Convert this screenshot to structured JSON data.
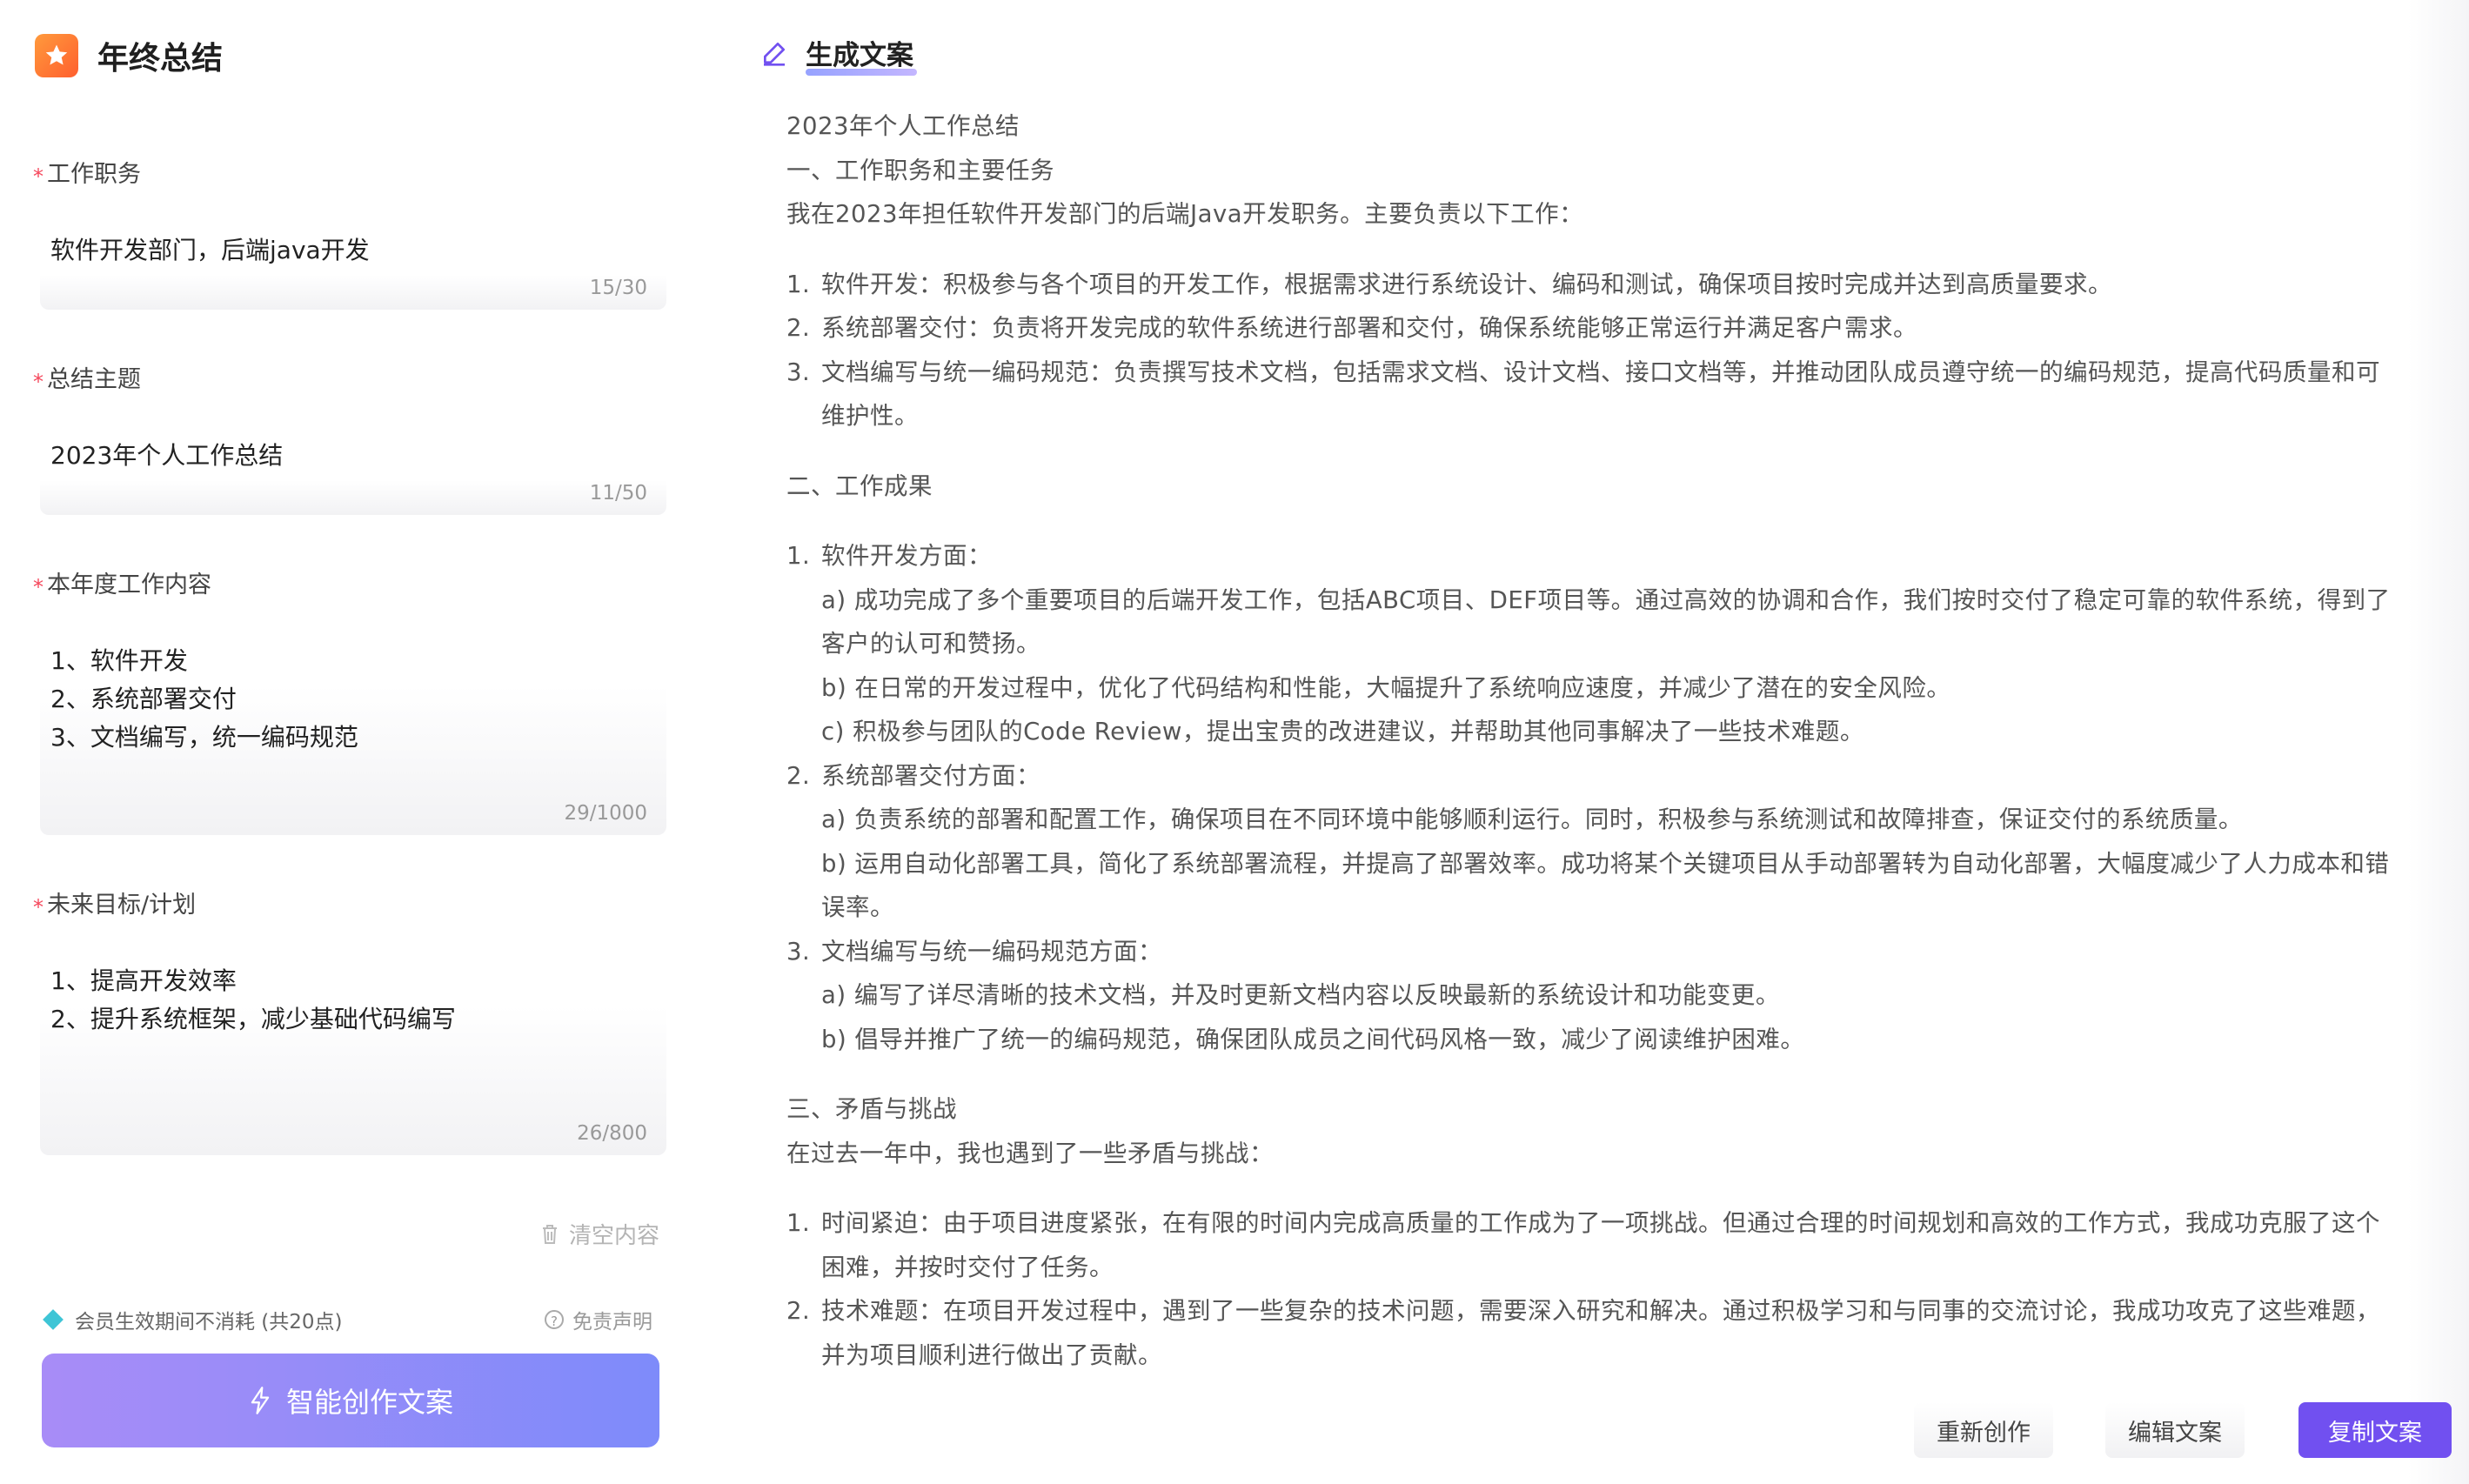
{
  "app": {
    "title": "年终总结"
  },
  "form": {
    "fields": [
      {
        "label": "工作职务",
        "value": "软件开发部门，后端java开发",
        "count": "15/30"
      },
      {
        "label": "总结主题",
        "value": "2023年个人工作总结",
        "count": "11/50"
      },
      {
        "label": "本年度工作内容",
        "value": "1、软件开发\n2、系统部署交付\n3、文档编写，统一编码规范",
        "count": "29/1000"
      },
      {
        "label": "未来目标/计划",
        "value": "1、提高开发效率\n2、提升系统框架，减少基础代码编写",
        "count": "26/800"
      }
    ],
    "clear_label": "清空内容",
    "member_note": "会员生效期间不消耗 (共20点)",
    "disclaimer_label": "免责声明",
    "create_label": "智能创作文案"
  },
  "result": {
    "title": "生成文案",
    "lines": {
      "l1": "2023年个人工作总结",
      "l2": "一、工作职务和主要任务",
      "l3": "我在2023年担任软件开发部门的后端Java开发职务。主要负责以下工作：",
      "a1n": "1.",
      "a1": "软件开发：积极参与各个项目的开发工作，根据需求进行系统设计、编码和测试，确保项目按时完成并达到高质量要求。",
      "a2n": "2.",
      "a2": "系统部署交付：负责将开发完成的软件系统进行部署和交付，确保系统能够正常运行并满足客户需求。",
      "a3n": "3.",
      "a3": "文档编写与统一编码规范：负责撰写技术文档，包括需求文档、设计文档、接口文档等，并推动团队成员遵守统一的编码规范，提高代码质量和可维护性。",
      "s2": "二、工作成果",
      "b1n": "1.",
      "b1": "软件开发方面：",
      "b1a": "a) 成功完成了多个重要项目的后端开发工作，包括ABC项目、DEF项目等。通过高效的协调和合作，我们按时交付了稳定可靠的软件系统，得到了客户的认可和赞扬。",
      "b1b": "b) 在日常的开发过程中，优化了代码结构和性能，大幅提升了系统响应速度，并减少了潜在的安全风险。",
      "b1c": "c) 积极参与团队的Code Review，提出宝贵的改进建议，并帮助其他同事解决了一些技术难题。",
      "b2n": "2.",
      "b2": "系统部署交付方面：",
      "b2a": "a) 负责系统的部署和配置工作，确保项目在不同环境中能够顺利运行。同时，积极参与系统测试和故障排查，保证交付的系统质量。",
      "b2b": "b) 运用自动化部署工具，简化了系统部署流程，并提高了部署效率。成功将某个关键项目从手动部署转为自动化部署，大幅度减少了人力成本和错误率。",
      "b3n": "3.",
      "b3": "文档编写与统一编码规范方面：",
      "b3a": "a) 编写了详尽清晰的技术文档，并及时更新文档内容以反映最新的系统设计和功能变更。",
      "b3b": "b) 倡导并推广了统一的编码规范，确保团队成员之间代码风格一致，减少了阅读维护困难。",
      "s3": "三、矛盾与挑战",
      "s3i": "在过去一年中，我也遇到了一些矛盾与挑战：",
      "c1n": "1.",
      "c1": "时间紧迫：由于项目进度紧张，在有限的时间内完成高质量的工作成为了一项挑战。但通过合理的时间规划和高效的工作方式，我成功克服了这个困难，并按时交付了任务。",
      "c2n": "2.",
      "c2": "技术难题：在项目开发过程中，遇到了一些复杂的技术问题，需要深入研究和解决。通过积极学习和与同事的交流讨论，我成功攻克了这些难题，并为项目顺利进行做出了贡献。"
    },
    "buttons": {
      "redo": "重新创作",
      "edit": "编辑文案",
      "copy": "复制文案"
    }
  },
  "colors": {
    "accent": "#7150f0",
    "required": "#f5475c",
    "logo": "#ff7a34",
    "create_gradient_start": "#a88cf7",
    "create_gradient_end": "#7e8bfa"
  },
  "icons": {
    "logo": "star-icon",
    "title": "pencil-icon",
    "clear": "trash-icon",
    "member": "diamond-icon",
    "disclaimer": "question-icon",
    "create": "lightning-icon"
  }
}
